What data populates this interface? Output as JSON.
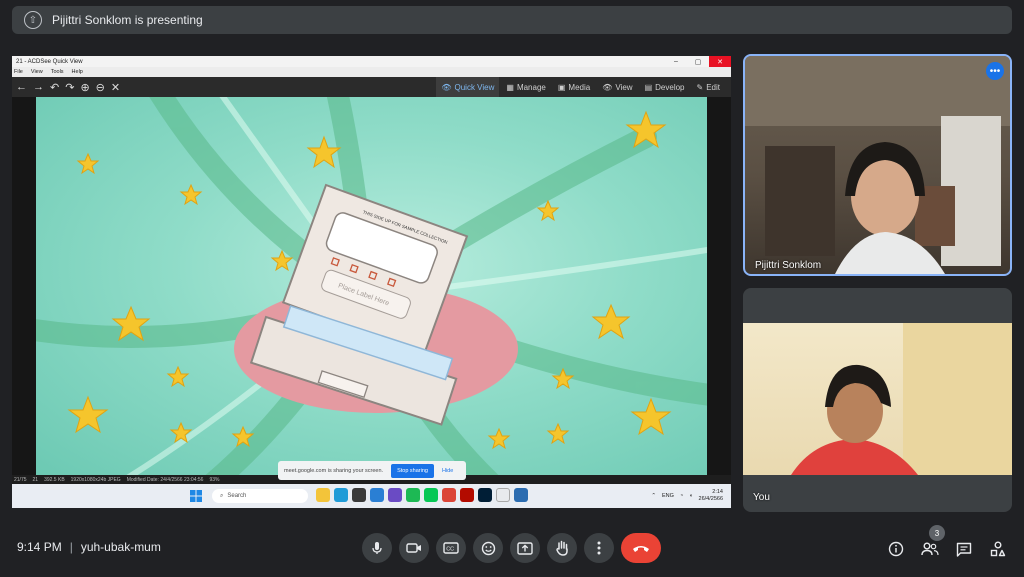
{
  "presenting_banner": {
    "text": "Pijittri Sonklom is presenting"
  },
  "acdsee": {
    "window_title": "21 - ACDSee Quick View",
    "menu": [
      "File",
      "View",
      "Tools",
      "Help"
    ],
    "modes": [
      {
        "label": "Quick View",
        "icon": "eye-icon"
      },
      {
        "label": "Manage",
        "icon": "grid-icon"
      },
      {
        "label": "Media",
        "icon": "media-icon"
      },
      {
        "label": "View",
        "icon": "eye-icon"
      },
      {
        "label": "Develop",
        "icon": "develop-icon"
      },
      {
        "label": "Edit",
        "icon": "edit-icon"
      }
    ],
    "status": [
      "21/75",
      "21",
      "392.5 KB",
      "1920x1080x24b JPEG",
      "Modified Date: 24/4/2566 23:04:56",
      "93%"
    ],
    "artwork_text": {
      "side_up": "THIS SIDE UP FOR SAMPLE COLLECTION",
      "place_label": "Place Label Here"
    }
  },
  "share_notice": {
    "text": "meet.google.com is sharing your screen.",
    "stop": "Stop sharing",
    "hide": "Hide"
  },
  "taskbar": {
    "search": "Search",
    "lang": "ENG",
    "time": "2:14",
    "date": "26/4/2566"
  },
  "participants": [
    {
      "name": "Pijittri Sonklom"
    },
    {
      "name": "You"
    }
  ],
  "meeting": {
    "time": "9:14 PM",
    "separator": "|",
    "code": "yuh-ubak-mum",
    "people_count": "3"
  },
  "colors": {
    "end_call": "#ea4335",
    "active_speaker": "#8ab4f8",
    "accent": "#1a73e8"
  }
}
